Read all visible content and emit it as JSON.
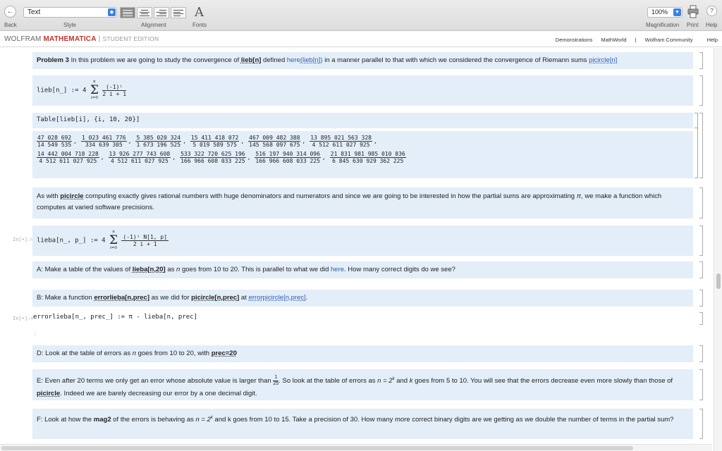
{
  "toolbar": {
    "back_label": "Back",
    "back_icon": "left-arrow-icon",
    "style_label": "Style",
    "style_value": "Text",
    "alignment_label": "Alignment",
    "fonts_label": "Fonts",
    "fonts_glyph": "A",
    "magnification_label": "Magnification",
    "magnification_value": "100%",
    "print_label": "Print",
    "help_label": "Help",
    "help_glyph": "?"
  },
  "brand": {
    "wolfram": "WOLFRAM",
    "mathematica": "MATHEMATICA",
    "separator": "|",
    "edition": "STUDENT EDITION"
  },
  "nav": {
    "demonstrations": "Demonstrations",
    "mathworld": "MathWorld",
    "separator": "|",
    "community": "Wolfram Community",
    "help": "Help"
  },
  "cells": {
    "problem": {
      "heading": "Problem 3",
      "text1": " In this problem we are going to study the convergence of ",
      "lieb": "lieb[n]",
      "text2": " defined ",
      "here": "here",
      "here_paren": "(lieb[n])",
      "text3": " in a manner parallel to that with which we considered the convergence of Riemann sums ",
      "picircle": "picircle[n]"
    },
    "lieb_def": {
      "lhs": "lieb[n_] := 4",
      "sum_top": "n",
      "sum_bot": "i=0",
      "num": "(-1)ⁱ",
      "den": "2 i + 1"
    },
    "table_input": "Table[lieb[i], {i, 10, 20}]",
    "table_output": {
      "row1": [
        {
          "n": "47 028 692",
          "d": "14 549 535"
        },
        {
          "n": "1 023 461 776",
          "d": "334 639 305"
        },
        {
          "n": "5 385 020 324",
          "d": "1 673 196 525"
        },
        {
          "n": "15 411 418 072",
          "d": "5 019 589 575"
        },
        {
          "n": "467 009 482 388",
          "d": "145 568 097 675"
        },
        {
          "n": "13 895 021 563 328",
          "d": "4 512 611 027 925"
        }
      ],
      "row2": [
        {
          "n": "14 442 004 718 228",
          "d": "4 512 611 027 925"
        },
        {
          "n": "13 926 277 743 608",
          "d": "4 512 611 027 925"
        },
        {
          "n": "533 322 720 625 196",
          "d": "166 966 608 033 225"
        },
        {
          "n": "516 197 940 314 096",
          "d": "166 966 608 033 225"
        },
        {
          "n": "21 831 981 985 010 836",
          "d": "6 845 630 929 362 225"
        }
      ]
    },
    "as_with": {
      "t1": "As with ",
      "picircle": "picircle",
      "t2": " computing exactly gives rational numbers with huge denominators and numerators and since we are going to be interested in how the partial sums are approximating ",
      "pi": "π",
      "t3": ", we make a function which computes at varied software precisions."
    },
    "lieba_label": "In[•]:=",
    "lieba_def": {
      "lhs": "lieba[n_, p_] := 4",
      "sum_top": "n",
      "sum_bot": "i=0",
      "num": "(-1)ⁱ N[1, p]",
      "den": "2 i + 1"
    },
    "a_text": {
      "t1": "A: Make a table of the values of ",
      "lieba": "lieba[n,20]",
      "t2": " as ",
      "n": "n",
      "t3": " goes from 10 to 20. This is parallel to what we did ",
      "here": "here",
      "t4": ". How many correct digits do we see?"
    },
    "b_text": {
      "t1": "B: Make a function ",
      "errorlieba": "errorlieba[n,prec]",
      "t2": " as we did for ",
      "picircle": "picircle[n,prec]",
      "t3": " at ",
      "errorpicircle": "errorpicircle[n,prec]",
      "t4": "."
    },
    "errorlieba_label": "In[•]:=",
    "errorlieba_def": "errorlieba[n_, prec_] := π - lieba[n, prec]",
    "d_text": {
      "t1": "D: Look at the table of errors as ",
      "n": "n",
      "t2": " goes from 10 to 20, with ",
      "prec": "prec=20"
    },
    "e_text": {
      "t1": "E: Even after 20 terms we only get an error whose absolute value is larger than ",
      "fn": "1",
      "fd": "25",
      "t2": ". So look at the table of errors as ",
      "eq": "n = 2",
      "sup": "k",
      "t3": " and ",
      "k": "k",
      "t4": " goes from 5 to 10. You will see that the errors decrease even more slowly than those of ",
      "picircle": "picircle",
      "t5": ". Indeed we are barely decreasing our error by a one decimal digit."
    },
    "f_text": {
      "t1": "F: Look at how the ",
      "mag2": "mag2",
      "t2": " of the errors is behaving as ",
      "eq": "n = 2",
      "sup": "k",
      "t3": " and k goes from 10 to 15. Take a precision of 30. How many more correct binary digits are we getting as we double the number of terms in the partial sum?"
    }
  }
}
